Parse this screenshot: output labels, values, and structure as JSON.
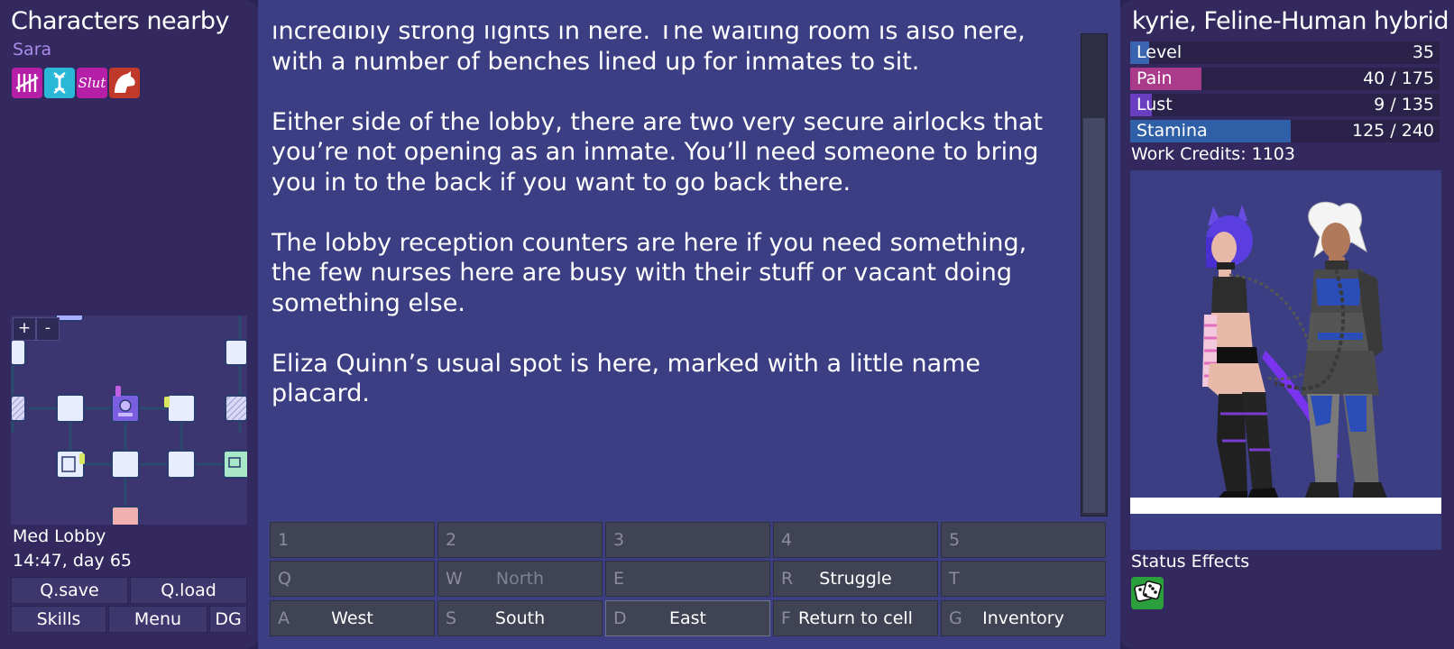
{
  "left_panel": {
    "title": "Characters nearby",
    "npc_name": "Sara",
    "npc_status_icons": [
      "tally-marks-icon",
      "dna-icon",
      "slut-tag-icon",
      "creature-icon"
    ],
    "npc_tag_text": "Slut",
    "minimap": {
      "zoom_in": "+",
      "zoom_out": "-"
    },
    "location": "Med Lobby",
    "time": "14:47, day 65",
    "buttons": {
      "qsave": "Q.save",
      "qload": "Q.load",
      "skills": "Skills",
      "menu": "Menu",
      "dg": "DG"
    }
  },
  "story": {
    "paragraphs": [
      "incredibly strong lights in here. The waiting room is also here, with a number of benches lined up for inmates to sit.",
      "Either side of the lobby, there are two very secure airlocks that you’re not opening as an inmate. You’ll need someone to bring you in to the back if you want to go back there.",
      "The lobby reception counters are here if you need something, the few nurses here are busy with their stuff or vacant doing something else.",
      "Eliza Quinn’s usual spot is here, marked with a little name placard."
    ]
  },
  "actions": [
    {
      "key": "1",
      "label": ""
    },
    {
      "key": "2",
      "label": ""
    },
    {
      "key": "3",
      "label": ""
    },
    {
      "key": "4",
      "label": ""
    },
    {
      "key": "5",
      "label": ""
    },
    {
      "key": "Q",
      "label": ""
    },
    {
      "key": "W",
      "label": "North"
    },
    {
      "key": "E",
      "label": ""
    },
    {
      "key": "R",
      "label": "Struggle"
    },
    {
      "key": "T",
      "label": ""
    },
    {
      "key": "A",
      "label": "West"
    },
    {
      "key": "S",
      "label": "South"
    },
    {
      "key": "D",
      "label": "East"
    },
    {
      "key": "F",
      "label": "Return to cell"
    },
    {
      "key": "G",
      "label": "Inventory"
    }
  ],
  "right_panel": {
    "player_name": "kyrie, Feline-Human hybrid",
    "stats": {
      "level": {
        "label": "Level",
        "value": "35",
        "fraction": 0.06,
        "color": "#3a64b0"
      },
      "pain": {
        "label": "Pain",
        "value": "40 / 175",
        "fraction": 0.23,
        "color": "#aa3b8a"
      },
      "lust": {
        "label": "Lust",
        "value": "9 / 135",
        "fraction": 0.07,
        "color": "#6a3ec0"
      },
      "stamina": {
        "label": "Stamina",
        "value": "125 / 240",
        "fraction": 0.52,
        "color": "#2f5fa6"
      }
    },
    "work_credits": "Work Credits: 1103",
    "status_effects_title": "Status Effects",
    "status_effect_icons": [
      "dice-icon"
    ]
  }
}
